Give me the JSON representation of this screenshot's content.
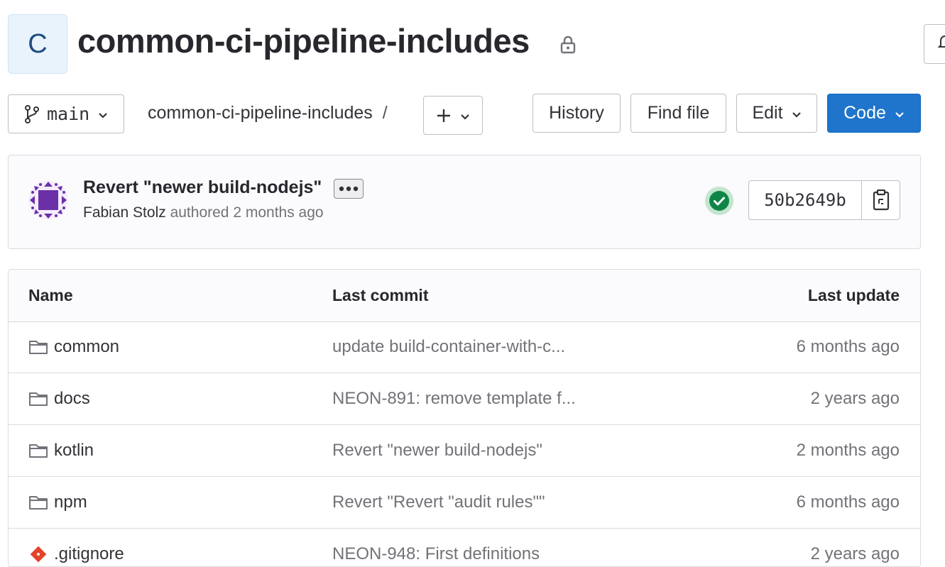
{
  "project": {
    "avatar_letter": "C",
    "title": "common-ci-pipeline-includes"
  },
  "toolbar": {
    "branch": "main",
    "breadcrumb_root": "common-ci-pipeline-includes",
    "breadcrumb_sep": "/",
    "history_label": "History",
    "find_file_label": "Find file",
    "edit_label": "Edit",
    "code_label": "Code",
    "code_color": "#1f75cb"
  },
  "commit": {
    "title": "Revert \"newer build-nodejs\"",
    "author": "Fabian Stolz",
    "action": "authored",
    "time": "2 months ago",
    "sha": "50b2649b",
    "pipeline_status": "passed",
    "status_color": "#108548"
  },
  "table": {
    "headers": {
      "name": "Name",
      "last_commit": "Last commit",
      "last_update": "Last update"
    },
    "rows": [
      {
        "icon": "folder-icon",
        "name": "common",
        "last_commit": "update build-container-with-c...",
        "last_update": "6 months ago"
      },
      {
        "icon": "folder-icon",
        "name": "docs",
        "last_commit": "NEON-891: remove template f...",
        "last_update": "2 years ago"
      },
      {
        "icon": "folder-icon",
        "name": "kotlin",
        "last_commit": "Revert \"newer build-nodejs\"",
        "last_update": "2 months ago"
      },
      {
        "icon": "folder-icon",
        "name": "npm",
        "last_commit": "Revert \"Revert \"audit rules\"\"",
        "last_update": "6 months ago"
      },
      {
        "icon": "git-file-icon",
        "name": ".gitignore",
        "last_commit": "NEON-948: First definitions",
        "last_update": "2 years ago"
      }
    ]
  }
}
